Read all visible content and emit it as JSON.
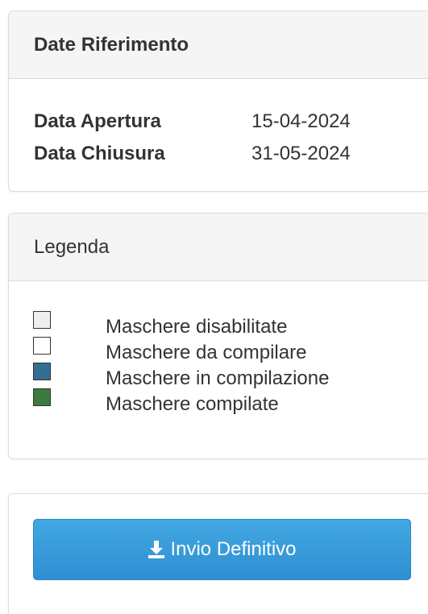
{
  "dates_panel": {
    "title": "Date Riferimento",
    "rows": [
      {
        "label": "Data Apertura",
        "value": "15-04-2024"
      },
      {
        "label": "Data Chiusura",
        "value": "31-05-2024"
      }
    ]
  },
  "legend_panel": {
    "title": "Legenda",
    "items": [
      {
        "label": "Maschere disabilitate",
        "color": "#eeeeee"
      },
      {
        "label": "Maschere da compilare",
        "color": "#ffffff"
      },
      {
        "label": "Maschere in compilazione",
        "color": "#336f91"
      },
      {
        "label": "Maschere compilate",
        "color": "#3d7a3d"
      }
    ]
  },
  "action_panel": {
    "submit_label": "Invio Definitivo",
    "submit_icon": "download-icon",
    "submit_color": "#3a9ddb"
  }
}
